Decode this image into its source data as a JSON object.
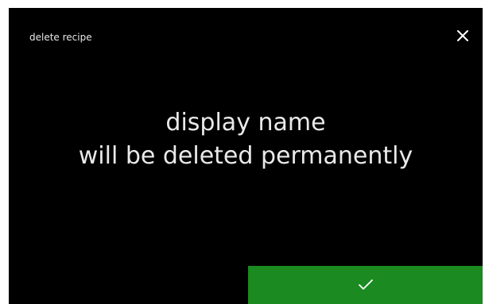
{
  "header": {
    "title": "delete recipe",
    "close_icon": "close-icon"
  },
  "message": {
    "line1": "display name",
    "line2": "will be deleted permanently"
  },
  "confirm": {
    "icon": "checkmark-icon",
    "background": "#1a8a21"
  },
  "colors": {
    "screen": "#000000",
    "text": "#e9e9e9",
    "accent_green": "#1a8a21"
  }
}
